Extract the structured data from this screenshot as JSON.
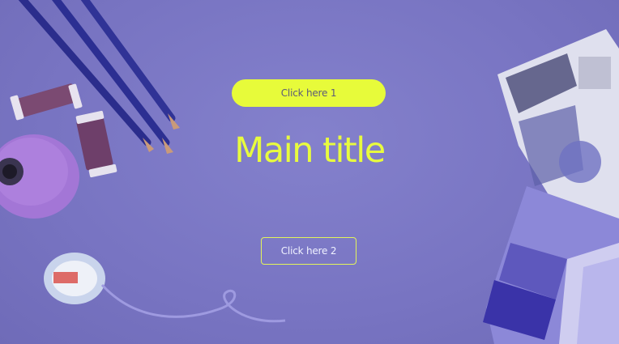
{
  "hero": {
    "primary_button_label": "Click here 1",
    "title": "Main title",
    "secondary_button_label": "Click here 2"
  },
  "colors": {
    "background": "#7b78c4",
    "accent": "#e7fb3a"
  },
  "background_image": {
    "objects": [
      "colored-pencils",
      "thread-spools",
      "yarn-cone",
      "ribbon-roll",
      "magazine-collage",
      "paint-swatch-cards"
    ]
  }
}
